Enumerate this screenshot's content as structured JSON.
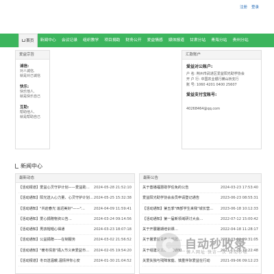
{
  "toplinks": {
    "register": "注册",
    "login": "登录"
  },
  "nav": {
    "items": [
      {
        "label": "首页",
        "active": true
      },
      {
        "label": "新闻中心"
      },
      {
        "label": "会议记录"
      },
      {
        "label": "组织教学"
      },
      {
        "label": "项目捐助"
      },
      {
        "label": "财务公开"
      },
      {
        "label": "爱益情感"
      },
      {
        "label": "媒体报道"
      },
      {
        "label": "甘肃分站"
      },
      {
        "label": "青海分站"
      },
      {
        "label": "贵州分站"
      }
    ]
  },
  "motto": {
    "heading": "爱益宗旨",
    "groups": [
      {
        "title": "诚信:",
        "lines": [
          "对人诚信,",
          "就是对己诚信"
        ]
      },
      {
        "title": "快乐:",
        "lines": [
          "快乐他人,",
          "就是快乐自己"
        ]
      },
      {
        "title": "互助:",
        "lines": [
          "帮助他人,",
          "就是帮助自己"
        ]
      }
    ]
  },
  "account": {
    "heading": "汇款账户",
    "title": "爱益对公账户:",
    "lines": [
      "户  名:  荆州市武进区爱益阳光助学协会",
      "开 户 行:  中国农业银行横山桥支行",
      "账  号:  1060 4201 0400 25607"
    ],
    "alipay_title": "爱益支付宝账号:",
    "alipay": "40268464@qq.com"
  },
  "news": {
    "section_title": "新闻中心",
    "left": {
      "heading": "最新动态",
      "rows": [
        {
          "t": "【活动报道】爱益心灵守护计划——爱益助…",
          "d": "2024-05-28 21:52:10"
        },
        {
          "t": "【活动通知】阳光送入心力量、心灵守护计划…",
          "d": "2024-05-25 15:32:38"
        },
        {
          "t": "【活动通知】\"共赴春光 追迟美好\"——\"…",
          "d": "2024-04-09 11:59:41"
        },
        {
          "t": "【活动通知】爱心捐赠物资公告…",
          "d": "2024-03-24 09:14:56"
        },
        {
          "t": "【活动通知】男孩帽帽心得通",
          "d": "2024-03-23 18:07:18"
        },
        {
          "t": "【活动通知】公益捐赠——在制服务",
          "d": "2024-03-02 21:56:52"
        },
        {
          "t": "【活动通知】\"暖冬情意\"捐入节义卖爱益市…",
          "d": "2024-02-05 19:54:20"
        },
        {
          "t": "【活动报道】冬日送温暖,温情伴你心安",
          "d": "2024-01-30 21:04:52"
        }
      ]
    },
    "right": {
      "heading": "最新公告",
      "rows": [
        {
          "t": "关于善播福慧助学任免的公告",
          "d": "2024-03-23 17:53:40"
        },
        {
          "t": "爱益阳光助学协会会员申请登记通告",
          "d": "2023-06-23 08:55:31"
        },
        {
          "t": "【活动通知】第五季\"西部学生来我\"城长营…",
          "d": "2023-06-18 10:12:33"
        },
        {
          "t": "【活动通知】第一届新领域研讨大会…",
          "d": "2022-07-12 15:00:42"
        },
        {
          "t": "关于开展暑期培训课…",
          "d": "2022-04-18 11:28:17"
        },
        {
          "t": "关于暑爱益青春合唱团…",
          "d": "2022-03-02 09:31:05"
        },
        {
          "t": "关于组建义工队伍的通知…",
          "d": "2021-11-16 10:22:48"
        },
        {
          "t": "关爱失独与残障家庭、慎重伴际爱益在行动",
          "d": "2021-09-06 09:12:23"
        }
      ]
    }
  },
  "watermark": {
    "text": "自动秒收录",
    "sub": "懒人网址·快访一次·自动秒收"
  }
}
